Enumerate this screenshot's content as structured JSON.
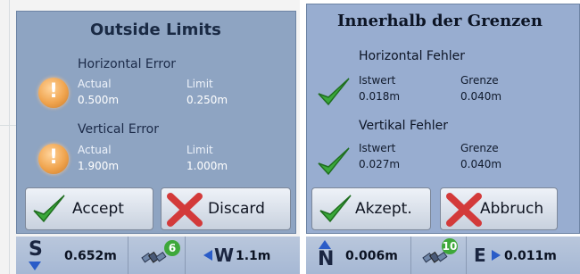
{
  "left": {
    "title": "Outside Limits",
    "horizontal": {
      "heading": "Horizontal Error",
      "actual_label": "Actual",
      "actual_value": "0.500m",
      "limit_label": "Limit",
      "limit_value": "0.250m"
    },
    "vertical": {
      "heading": "Vertical Error",
      "actual_label": "Actual",
      "actual_value": "1.900m",
      "limit_label": "Limit",
      "limit_value": "1.000m"
    },
    "accept_label": "Accept",
    "discard_label": "Discard",
    "status": {
      "north_south": "S",
      "distance_ns": "0.652m",
      "satellites": "6",
      "east_west": "W",
      "distance_ew": "1.1m"
    }
  },
  "right": {
    "title": "Innerhalb der Grenzen",
    "horizontal": {
      "heading": "Horizontal Fehler",
      "actual_label": "Istwert",
      "actual_value": "0.018m",
      "limit_label": "Grenze",
      "limit_value": "0.040m"
    },
    "vertical": {
      "heading": "Vertikal Fehler",
      "actual_label": "Istwert",
      "actual_value": "0.027m",
      "limit_label": "Grenze",
      "limit_value": "0.040m"
    },
    "accept_label": "Akzept.",
    "discard_label": "Abbruch",
    "status": {
      "north_south": "N",
      "distance_ns": "0.006m",
      "satellites": "10",
      "east_west": "E",
      "distance_ew": "0.011m"
    }
  },
  "colors": {
    "dialog_bg": "#93a8c4",
    "warning": "#f0a44e",
    "check_green": "#3aa83a",
    "cross_red": "#d33a3a"
  },
  "icons": {
    "warning": "warning-icon",
    "ok": "checkmark-icon",
    "accept": "checkmark-icon",
    "discard": "x-mark-icon",
    "satellite": "satellite-icon"
  }
}
